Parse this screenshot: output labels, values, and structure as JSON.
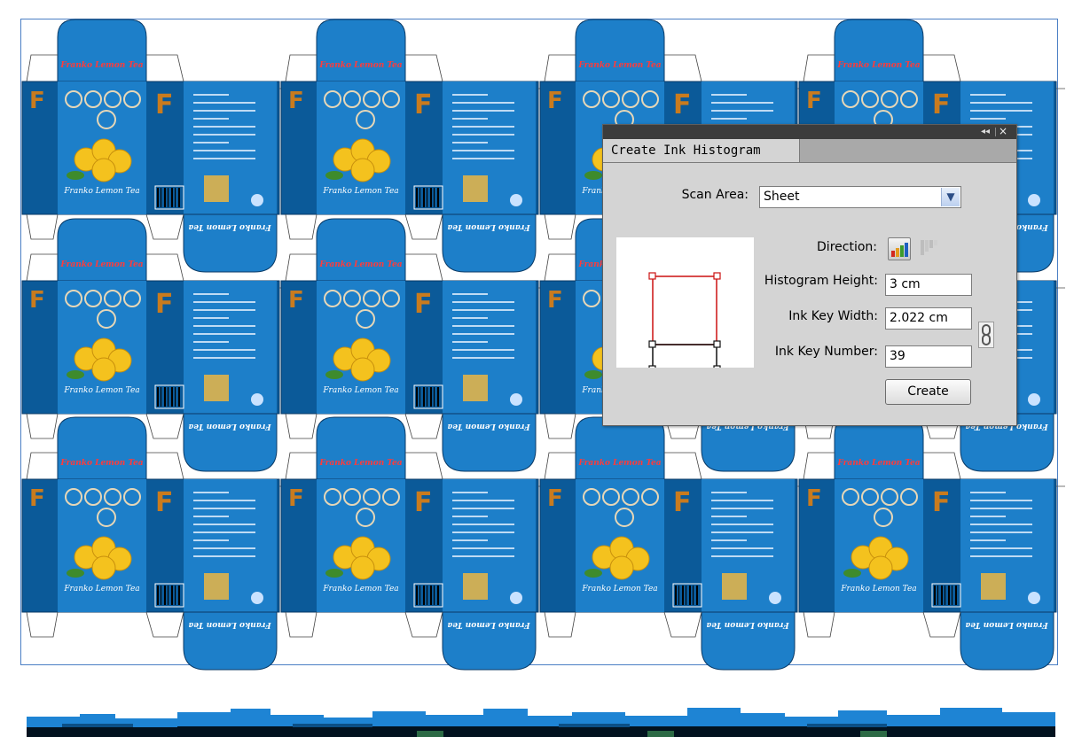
{
  "artwork": {
    "box_brand_text": "Franko Lemon Tea",
    "box_logo_letter": "F",
    "colors": {
      "box_blue": "#1d7fc9",
      "box_dark_blue": "#0b5a99",
      "lemon": "#f4c21e",
      "logo_orange": "#c97b1e",
      "sheet_border": "#4a7fc4"
    }
  },
  "dialog": {
    "title": "Create Ink Histogram",
    "collapse_icon": "◂◂",
    "close_icon": "×",
    "scan_area_label": "Scan Area:",
    "scan_area_value": "Sheet",
    "direction_label": "Direction:",
    "histogram_height_label": "Histogram Height:",
    "histogram_height_value": "3 cm",
    "ink_key_width_label": "Ink Key Width:",
    "ink_key_width_value": "2.022 cm",
    "ink_key_number_label": "Ink Key Number:",
    "ink_key_number_value": "39",
    "create_label": "Create"
  }
}
